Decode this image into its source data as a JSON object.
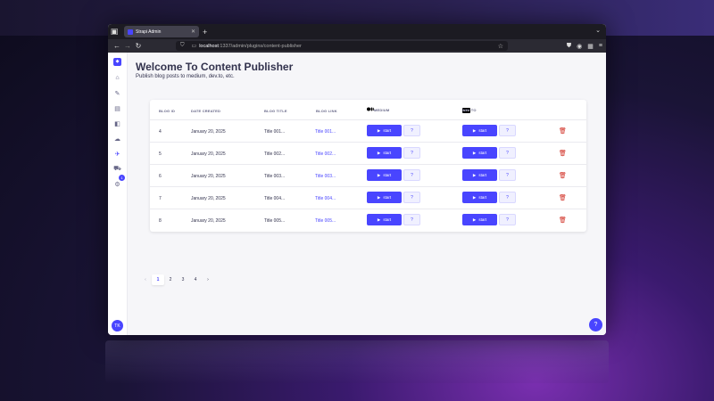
{
  "browser": {
    "tab_title": "Strapi Admin",
    "url_host": "localhost",
    "url_rest": ":1337/admin/plugins/content-publisher"
  },
  "sidebar": {
    "badge_count": "1",
    "avatar_initials": "TK"
  },
  "page": {
    "title": "Welcome To Content Publisher",
    "subtitle": "Publish blog posts to medium, dev.to, etc."
  },
  "table": {
    "headers": {
      "blog_id": "BLOG ID",
      "date_created": "DATE CREATED",
      "blog_title": "BLOG TITLE",
      "blog_link": "BLOG LINK",
      "medium": "MEDIUM",
      "devto": "DEV.TO",
      "devto_logo": "DEV"
    },
    "start_label": "start",
    "help_label": "?",
    "rows": [
      {
        "id": "4",
        "date": "January 20, 2025",
        "title": "Title 001...",
        "link": "Title 001..."
      },
      {
        "id": "5",
        "date": "January 20, 2025",
        "title": "Title 002...",
        "link": "Title 002..."
      },
      {
        "id": "6",
        "date": "January 20, 2025",
        "title": "Title 003...",
        "link": "Title 003..."
      },
      {
        "id": "7",
        "date": "January 20, 2025",
        "title": "Title 004...",
        "link": "Title 004..."
      },
      {
        "id": "8",
        "date": "January 20, 2025",
        "title": "Title 005...",
        "link": "Title 005..."
      }
    ]
  },
  "pagination": {
    "prev": "‹",
    "pages": [
      "1",
      "2",
      "3",
      "4"
    ],
    "active_page": "1",
    "next": "›"
  },
  "colors": {
    "accent": "#4945ff",
    "danger": "#d02b20"
  }
}
